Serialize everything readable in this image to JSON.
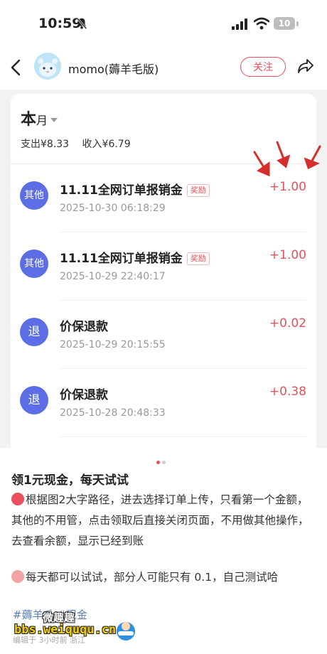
{
  "status_bar": {
    "time": "10:59",
    "battery": "10"
  },
  "header": {
    "title": "momo(薅羊毛版)",
    "follow_label": "关注"
  },
  "summary": {
    "month_main": "本",
    "month_sub": "月",
    "expense": "支出¥8.33",
    "income": "收入¥6.79"
  },
  "transactions": [
    {
      "icon_text": "其他",
      "title": "11.11全网订单报销金",
      "badge": "奖励",
      "date": "2025-10-30 06:18:29",
      "amount": "+1.00"
    },
    {
      "icon_text": "其他",
      "title": "11.11全网订单报销金",
      "badge": "奖励",
      "date": "2025-10-29 22:40:17",
      "amount": "+1.00"
    },
    {
      "icon_text": "退",
      "title": "价保退款",
      "badge": "",
      "date": "2025-10-29 20:15:55",
      "amount": "+0.02"
    },
    {
      "icon_text": "退",
      "title": "价保退款",
      "badge": "",
      "date": "2025-10-28 20:48:33",
      "amount": "+0.38"
    }
  ],
  "post": {
    "title": "领1元现金，每天试试",
    "paragraph1": "根据图2大字路径，进去选择订单上传，只看第一个金额，其他的不用管，点击领取后直接关闭页面，不用做其他操作，去查看余额，显示已经到账",
    "paragraph2": "每天都可以试试，部分人可能只有 0.1，自己测试哈",
    "tags": "#薅羊毛  #现金",
    "edited": "编辑于 3小时前 浙江"
  },
  "watermark": {
    "top": "微趣趣",
    "url": "bbs.weiququ.cn"
  },
  "colors": {
    "accent": "#e8505b",
    "icon_bg": "#5b6ee6",
    "tag": "#5b7fb0",
    "watermark": "#f4d000"
  },
  "icons": [
    "bell-slash-icon",
    "cellular-signal-icon",
    "wifi-icon",
    "battery-icon",
    "back-chevron-icon",
    "share-icon",
    "dropdown-caret-icon"
  ]
}
